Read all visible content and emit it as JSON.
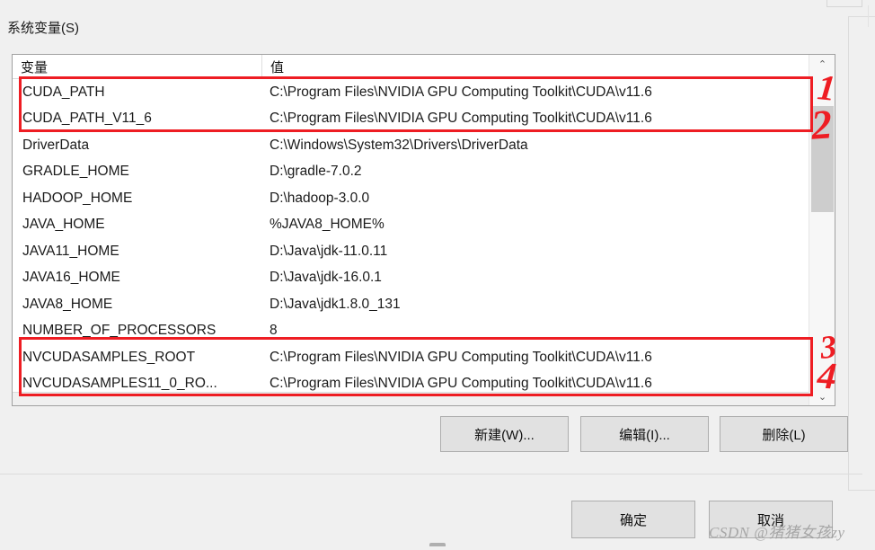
{
  "dialog": {
    "group_label": "系统变量(S)"
  },
  "table": {
    "columns": [
      "变量",
      "值"
    ],
    "rows": [
      {
        "name": "CUDA_PATH",
        "value": "C:\\Program Files\\NVIDIA GPU Computing Toolkit\\CUDA\\v11.6"
      },
      {
        "name": "CUDA_PATH_V11_6",
        "value": "C:\\Program Files\\NVIDIA GPU Computing Toolkit\\CUDA\\v11.6"
      },
      {
        "name": "DriverData",
        "value": "C:\\Windows\\System32\\Drivers\\DriverData"
      },
      {
        "name": "GRADLE_HOME",
        "value": "D:\\gradle-7.0.2"
      },
      {
        "name": "HADOOP_HOME",
        "value": "D:\\hadoop-3.0.0"
      },
      {
        "name": "JAVA_HOME",
        "value": "%JAVA8_HOME%"
      },
      {
        "name": "JAVA11_HOME",
        "value": "D:\\Java\\jdk-11.0.11"
      },
      {
        "name": "JAVA16_HOME",
        "value": "D:\\Java\\jdk-16.0.1"
      },
      {
        "name": "JAVA8_HOME",
        "value": "D:\\Java\\jdk1.8.0_131"
      },
      {
        "name": "NUMBER_OF_PROCESSORS",
        "value": "8"
      },
      {
        "name": "NVCUDASAMPLES_ROOT",
        "value": "C:\\Program Files\\NVIDIA GPU Computing Toolkit\\CUDA\\v11.6"
      },
      {
        "name": "NVCUDASAMPLES11_0_RO...",
        "value": "C:\\Program Files\\NVIDIA GPU Computing Toolkit\\CUDA\\v11.6"
      }
    ]
  },
  "scrollbar": {
    "up_arrow": "⌃",
    "down_arrow": "⌄"
  },
  "buttons": {
    "new": "新建(W)...",
    "edit": "编辑(I)...",
    "delete": "删除(L)",
    "ok": "确定",
    "cancel": "取消"
  },
  "annotations": {
    "numbers": [
      "1",
      "2",
      "3",
      "4"
    ],
    "box_color": "#ee1d23"
  },
  "watermark": {
    "text": "CSDN @猪猪女孩zy"
  }
}
